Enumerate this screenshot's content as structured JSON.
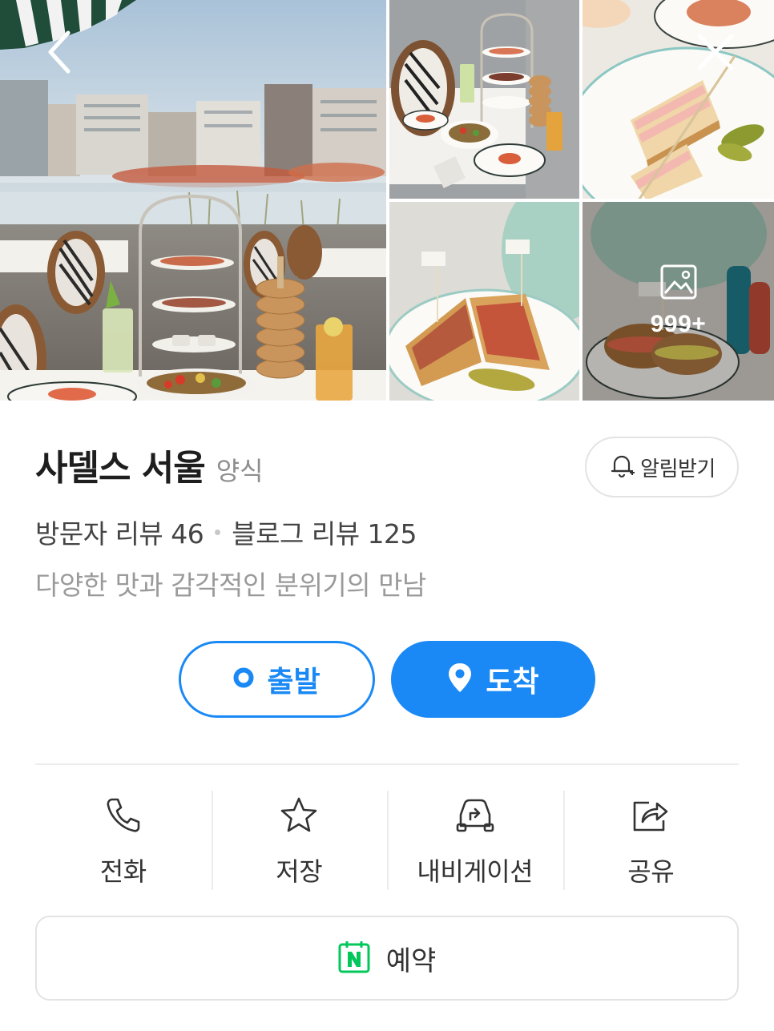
{
  "place": {
    "name": "사델스 서울",
    "category": "양식",
    "tagline": "다양한 맛과 감각적인 분위기의 만남"
  },
  "reviews": {
    "visitor": "방문자 리뷰 46",
    "blog": "블로그 리뷰 125"
  },
  "gallery": {
    "more_count": "999+",
    "icons": {
      "back": "chevron-left-icon",
      "close": "close-icon",
      "photos": "image-icon"
    }
  },
  "alarm": {
    "label": "알림받기",
    "icon": "bell-plus-icon"
  },
  "route": {
    "depart_label": "출발",
    "arrive_label": "도착",
    "accent_color": "#1a89f5"
  },
  "actions": [
    {
      "label": "전화",
      "icon": "phone-icon"
    },
    {
      "label": "저장",
      "icon": "star-icon"
    },
    {
      "label": "내비게이션",
      "icon": "car-navigation-icon"
    },
    {
      "label": "공유",
      "icon": "share-icon"
    }
  ],
  "reserve": {
    "label": "예약",
    "icon": "naver-booking-icon",
    "icon_color": "#03c75a"
  }
}
